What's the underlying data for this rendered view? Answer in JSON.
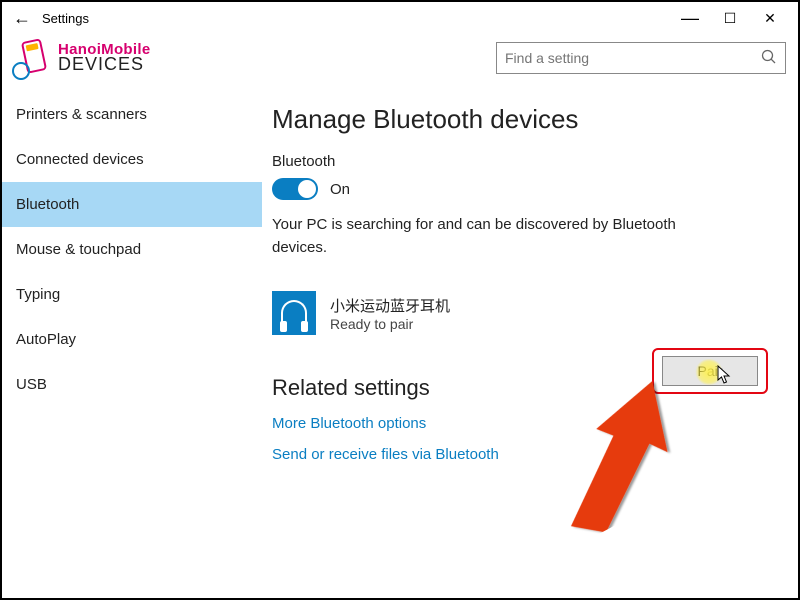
{
  "window": {
    "title": "Settings",
    "minimize": "—",
    "maximize": "☐",
    "close": "✕"
  },
  "header": {
    "brand_top": "HanoiMobile",
    "heading": "DEVICES"
  },
  "search": {
    "placeholder": "Find a setting"
  },
  "sidebar": {
    "items": [
      {
        "label": "Printers & scanners",
        "active": false
      },
      {
        "label": "Connected devices",
        "active": false
      },
      {
        "label": "Bluetooth",
        "active": true
      },
      {
        "label": "Mouse & touchpad",
        "active": false
      },
      {
        "label": "Typing",
        "active": false
      },
      {
        "label": "AutoPlay",
        "active": false
      },
      {
        "label": "USB",
        "active": false
      }
    ]
  },
  "main": {
    "title": "Manage Bluetooth devices",
    "toggle_section_label": "Bluetooth",
    "toggle_state_label": "On",
    "toggle_on": true,
    "search_status": "Your PC is searching for and can be discovered by Bluetooth devices.",
    "device": {
      "name": "小米运动蓝牙耳机",
      "status": "Ready to pair"
    },
    "pair_button": "Pair",
    "related_heading": "Related settings",
    "links": [
      "More Bluetooth options",
      "Send or receive files via Bluetooth"
    ]
  }
}
